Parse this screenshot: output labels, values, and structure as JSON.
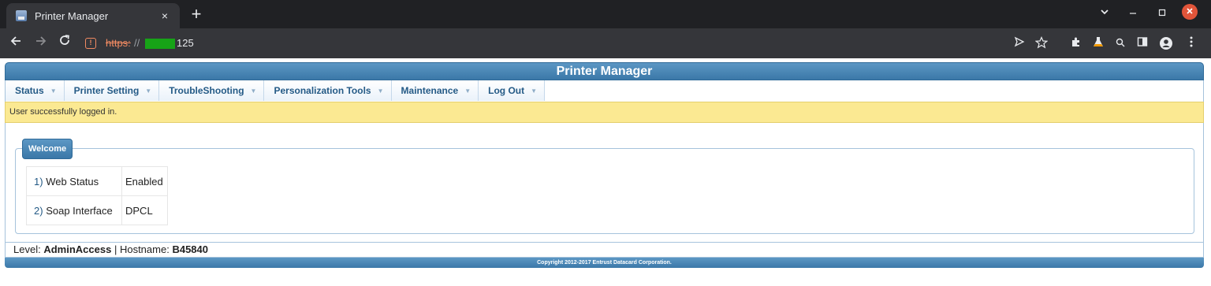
{
  "browser": {
    "tab_title": "Printer Manager",
    "tab_close": "×",
    "new_tab": "+",
    "url_scheme": "https:",
    "url_sep": "//",
    "url_host": "125"
  },
  "page": {
    "header_title": "Printer Manager",
    "nav": [
      {
        "label": "Status"
      },
      {
        "label": "Printer Setting"
      },
      {
        "label": "TroubleShooting"
      },
      {
        "label": "Personalization Tools"
      },
      {
        "label": "Maintenance"
      },
      {
        "label": "Log Out"
      }
    ],
    "notice": "User successfully logged in.",
    "welcome_legend": "Welcome",
    "rows": [
      {
        "num": "1)",
        "key": "Web Status",
        "value": "Enabled"
      },
      {
        "num": "2)",
        "key": "Soap Interface",
        "value": "DPCL"
      }
    ],
    "status": {
      "level_label": "Level:",
      "level_value": "AdminAccess",
      "separator": "|",
      "hostname_label": "Hostname:",
      "hostname_value": "B45840"
    },
    "footer": "Copyright 2012-2017 Entrust Datacard Corporation."
  }
}
